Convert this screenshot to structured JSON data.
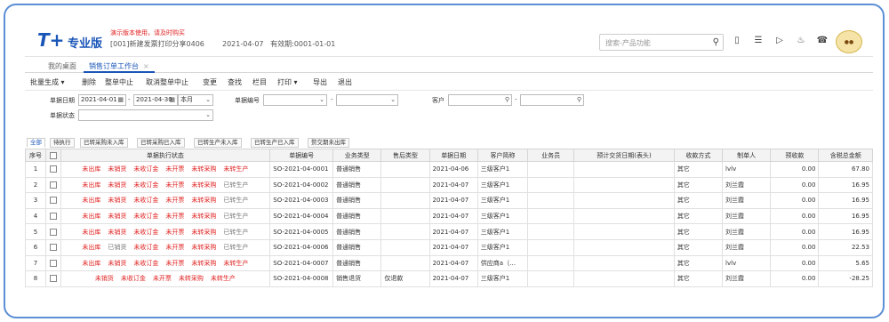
{
  "header": {
    "logo_text": "T+",
    "logo_sub": "专业版",
    "brand": "专业版",
    "trial_notice": "演示版本使用，请及时购买",
    "account": "[001]新建发票打印分享0406",
    "date": "2021-04-07",
    "validity": "有效期:0001-01-01",
    "search_placeholder": "搜索-产品功能"
  },
  "tabs": [
    {
      "label": "我的桌面"
    },
    {
      "label": "销售订单工作台",
      "close": "×"
    }
  ],
  "toolbar": [
    "批量生成",
    "删除",
    "整单中止",
    "取消整单中止",
    "变更",
    "查找",
    "栏目",
    "打印",
    "导出",
    "退出"
  ],
  "filters": {
    "date_label": "单据日期",
    "date_from": "2021-04-01",
    "date_to": "2021-04-30",
    "period": "本月",
    "docno_label": "单据编号",
    "customer_label": "客户",
    "status_label": "单据状态",
    "dash": "-"
  },
  "status_tabs": [
    "全部",
    "待执行",
    "已转采购未入库",
    "已转采购已入库",
    "已转生产未入库",
    "已转生产已入库",
    "赘交期未出库"
  ],
  "columns": [
    "序号",
    "",
    "单据执行状态",
    "单据编号",
    "业务类型",
    "售后类型",
    "单据日期",
    "客户简称",
    "业务员",
    "预计交货日期(表头)",
    "收款方式",
    "制单人",
    "预收款",
    "含税总金额"
  ],
  "rows": [
    {
      "no": "1",
      "status": [
        [
          "未出库",
          "red"
        ],
        [
          "未销货",
          "red"
        ],
        [
          "未收订金",
          "red"
        ],
        [
          "未开票",
          "red"
        ],
        [
          "未转采购",
          "red"
        ],
        [
          "未转生产",
          "red"
        ]
      ],
      "docno": "SO-2021-04-0001",
      "biz": "普通销售",
      "after": "",
      "date": "2021-04-06",
      "cust": "三级客户1",
      "sales": "",
      "eta": "",
      "pay": "其它",
      "maker": "lvlv",
      "pre": "0.00",
      "total": "67.80"
    },
    {
      "no": "2",
      "status": [
        [
          "未出库",
          "red"
        ],
        [
          "未销货",
          "red"
        ],
        [
          "未收订金",
          "red"
        ],
        [
          "未开票",
          "red"
        ],
        [
          "未转采购",
          "red"
        ],
        [
          "已转生产",
          "gray"
        ]
      ],
      "docno": "SO-2021-04-0002",
      "biz": "普通销售",
      "after": "",
      "date": "2021-04-07",
      "cust": "三级客户1",
      "sales": "",
      "eta": "",
      "pay": "其它",
      "maker": "刘兰霞",
      "pre": "0.00",
      "total": "16.95"
    },
    {
      "no": "3",
      "status": [
        [
          "未出库",
          "red"
        ],
        [
          "未销货",
          "red"
        ],
        [
          "未收订金",
          "red"
        ],
        [
          "未开票",
          "red"
        ],
        [
          "未转采购",
          "red"
        ],
        [
          "已转生产",
          "gray"
        ]
      ],
      "docno": "SO-2021-04-0003",
      "biz": "普通销售",
      "after": "",
      "date": "2021-04-07",
      "cust": "三级客户1",
      "sales": "",
      "eta": "",
      "pay": "其它",
      "maker": "刘兰霞",
      "pre": "0.00",
      "total": "16.95"
    },
    {
      "no": "4",
      "status": [
        [
          "未出库",
          "red"
        ],
        [
          "未销货",
          "red"
        ],
        [
          "未收订金",
          "red"
        ],
        [
          "未开票",
          "red"
        ],
        [
          "未转采购",
          "red"
        ],
        [
          "已转生产",
          "gray"
        ]
      ],
      "docno": "SO-2021-04-0004",
      "biz": "普通销售",
      "after": "",
      "date": "2021-04-07",
      "cust": "三级客户1",
      "sales": "",
      "eta": "",
      "pay": "其它",
      "maker": "刘兰霞",
      "pre": "0.00",
      "total": "16.95"
    },
    {
      "no": "5",
      "status": [
        [
          "未出库",
          "red"
        ],
        [
          "未销货",
          "red"
        ],
        [
          "未收订金",
          "red"
        ],
        [
          "未开票",
          "red"
        ],
        [
          "未转采购",
          "red"
        ],
        [
          "已转生产",
          "gray"
        ]
      ],
      "docno": "SO-2021-04-0005",
      "biz": "普通销售",
      "after": "",
      "date": "2021-04-07",
      "cust": "三级客户1",
      "sales": "",
      "eta": "",
      "pay": "其它",
      "maker": "刘兰霞",
      "pre": "0.00",
      "total": "16.95"
    },
    {
      "no": "6",
      "status": [
        [
          "未出库",
          "red"
        ],
        [
          "已销货",
          "gray"
        ],
        [
          "未收订金",
          "red"
        ],
        [
          "未开票",
          "red"
        ],
        [
          "未转采购",
          "red"
        ],
        [
          "已转生产",
          "gray"
        ]
      ],
      "docno": "SO-2021-04-0006",
      "biz": "普通销售",
      "after": "",
      "date": "2021-04-07",
      "cust": "三级客户1",
      "sales": "",
      "eta": "",
      "pay": "其它",
      "maker": "刘兰霞",
      "pre": "0.00",
      "total": "22.53"
    },
    {
      "no": "7",
      "status": [
        [
          "未出库",
          "red"
        ],
        [
          "未销货",
          "red"
        ],
        [
          "未收订金",
          "red"
        ],
        [
          "未开票",
          "red"
        ],
        [
          "未转采购",
          "red"
        ],
        [
          "未转生产",
          "red"
        ]
      ],
      "docno": "SO-2021-04-0007",
      "biz": "普通销售",
      "after": "",
      "date": "2021-04-07",
      "cust": "供应商a（…",
      "sales": "",
      "eta": "",
      "pay": "其它",
      "maker": "lvlv",
      "pre": "0.00",
      "total": "5.65"
    },
    {
      "no": "8",
      "status": [
        [
          "未销货",
          "red"
        ],
        [
          "未收订金",
          "red"
        ],
        [
          "未开票",
          "red"
        ],
        [
          "未转采购",
          "red"
        ],
        [
          "未转生产",
          "red"
        ]
      ],
      "docno": "SO-2021-04-0008",
      "biz": "销售退货",
      "after": "仅退款",
      "date": "2021-04-07",
      "cust": "三级客户1",
      "sales": "",
      "eta": "",
      "pay": "其它",
      "maker": "刘兰霞",
      "pre": "0.00",
      "total": "-28.25"
    }
  ]
}
